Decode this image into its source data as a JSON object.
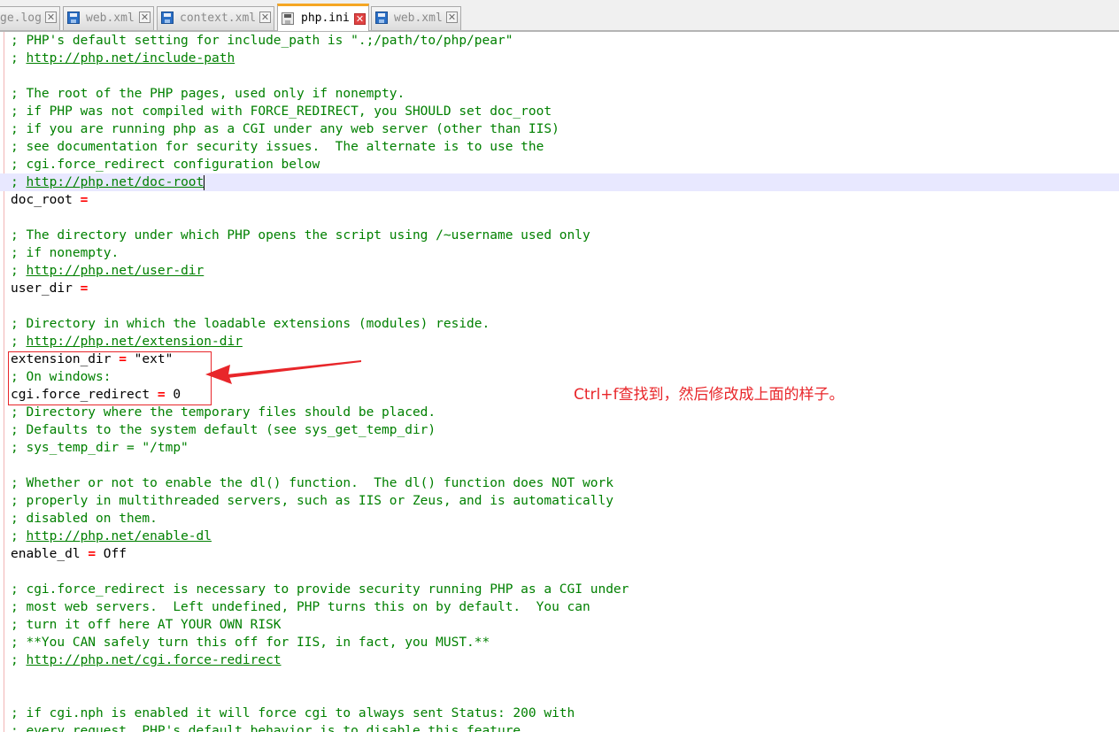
{
  "tabs": [
    {
      "label": "ge.log",
      "active": false,
      "icon": "log-file-icon"
    },
    {
      "label": "web.xml",
      "active": false,
      "icon": "save-file-icon"
    },
    {
      "label": "context.xml",
      "active": false,
      "icon": "save-file-icon"
    },
    {
      "label": "php.ini",
      "active": true,
      "icon": "save-file-icon"
    },
    {
      "label": "web.xml",
      "active": false,
      "icon": "save-file-icon"
    }
  ],
  "close_glyph": "✕",
  "colors": {
    "comment": "#008000",
    "operator": "#ff0000",
    "annotation": "#e8262a",
    "current_line": "#e8e8ff",
    "active_tab_accent": "#f5a623"
  },
  "editor": {
    "lines": [
      {
        "type": "comment",
        "text": "; PHP's default setting for include_path is \".;/path/to/php/pear\""
      },
      {
        "type": "comment_url",
        "prefix": "; ",
        "url": "http://php.net/include-path"
      },
      {
        "type": "blank"
      },
      {
        "type": "comment",
        "text": "; The root of the PHP pages, used only if nonempty."
      },
      {
        "type": "comment",
        "text": "; if PHP was not compiled with FORCE_REDIRECT, you SHOULD set doc_root"
      },
      {
        "type": "comment",
        "text": "; if you are running php as a CGI under any web server (other than IIS)"
      },
      {
        "type": "comment",
        "text": "; see documentation for security issues.  The alternate is to use the"
      },
      {
        "type": "comment",
        "text": "; cgi.force_redirect configuration below"
      },
      {
        "type": "comment_url",
        "prefix": "; ",
        "url": "http://php.net/doc-root",
        "current": true
      },
      {
        "type": "setting",
        "key": "doc_root ",
        "op": "=",
        "value": ""
      },
      {
        "type": "blank"
      },
      {
        "type": "comment",
        "text": "; The directory under which PHP opens the script using /~username used only"
      },
      {
        "type": "comment",
        "text": "; if nonempty."
      },
      {
        "type": "comment_url",
        "prefix": "; ",
        "url": "http://php.net/user-dir"
      },
      {
        "type": "setting",
        "key": "user_dir ",
        "op": "=",
        "value": ""
      },
      {
        "type": "blank"
      },
      {
        "type": "comment",
        "text": "; Directory in which the loadable extensions (modules) reside."
      },
      {
        "type": "comment_url",
        "prefix": "; ",
        "url": "http://php.net/extension-dir"
      },
      {
        "type": "setting",
        "key": "extension_dir ",
        "op": "=",
        "value": " \"ext\""
      },
      {
        "type": "comment",
        "text": "; On windows:"
      },
      {
        "type": "setting",
        "key": "cgi.force_redirect ",
        "op": "=",
        "value": " 0"
      },
      {
        "type": "comment",
        "text": "; Directory where the temporary files should be placed."
      },
      {
        "type": "comment",
        "text": "; Defaults to the system default (see sys_get_temp_dir)"
      },
      {
        "type": "comment",
        "text": "; sys_temp_dir = \"/tmp\""
      },
      {
        "type": "blank"
      },
      {
        "type": "comment",
        "text": "; Whether or not to enable the dl() function.  The dl() function does NOT work"
      },
      {
        "type": "comment",
        "text": "; properly in multithreaded servers, such as IIS or Zeus, and is automatically"
      },
      {
        "type": "comment",
        "text": "; disabled on them."
      },
      {
        "type": "comment_url",
        "prefix": "; ",
        "url": "http://php.net/enable-dl"
      },
      {
        "type": "setting",
        "key": "enable_dl ",
        "op": "=",
        "value": " Off"
      },
      {
        "type": "blank"
      },
      {
        "type": "comment",
        "text": "; cgi.force_redirect is necessary to provide security running PHP as a CGI under"
      },
      {
        "type": "comment",
        "text": "; most web servers.  Left undefined, PHP turns this on by default.  You can"
      },
      {
        "type": "comment",
        "text": "; turn it off here AT YOUR OWN RISK"
      },
      {
        "type": "comment",
        "text": "; **You CAN safely turn this off for IIS, in fact, you MUST.**"
      },
      {
        "type": "comment_url",
        "prefix": "; ",
        "url": "http://php.net/cgi.force-redirect"
      },
      {
        "type": "blank"
      },
      {
        "type": "blank"
      },
      {
        "type": "comment",
        "text": "; if cgi.nph is enabled it will force cgi to always sent Status: 200 with"
      },
      {
        "type": "comment",
        "text": "; every request. PHP's default behavior is to disable this feature."
      }
    ]
  },
  "annotation": {
    "note": "Ctrl+f查找到，然后修改成上面的样子。"
  }
}
